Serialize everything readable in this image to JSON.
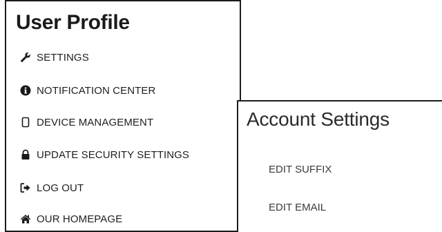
{
  "profile": {
    "title": "User Profile",
    "items": [
      {
        "label": "SETTINGS",
        "icon": "wrench-icon"
      },
      {
        "label": "NOTIFICATION CENTER",
        "icon": "info-circle-icon"
      },
      {
        "label": "DEVICE MANAGEMENT",
        "icon": "mobile-device-icon"
      },
      {
        "label": "UPDATE SECURITY SETTINGS",
        "icon": "lock-icon"
      },
      {
        "label": "LOG OUT",
        "icon": "sign-out-icon"
      },
      {
        "label": "OUR HOMEPAGE",
        "icon": "home-icon"
      }
    ]
  },
  "account": {
    "title": "Account Settings",
    "links": [
      {
        "label": "EDIT SUFFIX"
      },
      {
        "label": "EDIT EMAIL"
      }
    ]
  },
  "colors": {
    "border": "#1a1a1a",
    "text": "#1e1e1e",
    "background": "#ffffff"
  }
}
